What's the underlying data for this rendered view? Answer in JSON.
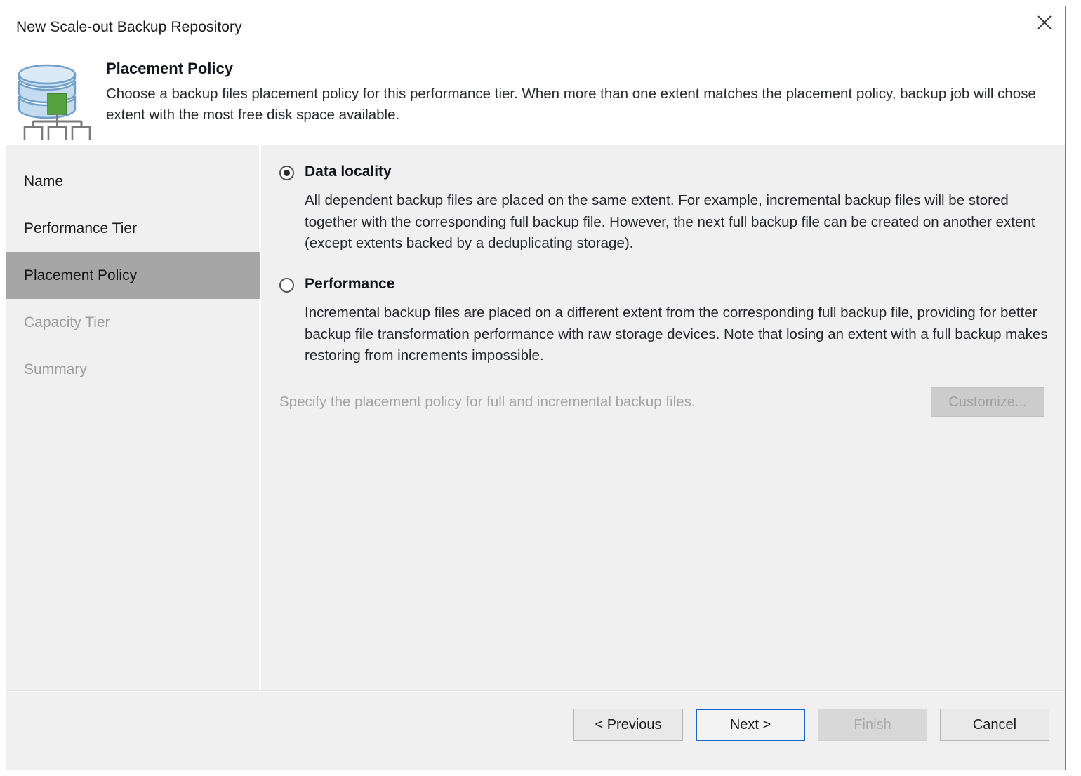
{
  "window": {
    "title": "New Scale-out Backup Repository",
    "close_icon": "close-icon"
  },
  "header": {
    "icon": "scale-out-repository-icon",
    "title": "Placement Policy",
    "description": "Choose a backup files placement policy for this performance tier. When more than one extent matches the placement policy, backup job will chose extent with the most free disk space available."
  },
  "sidebar": {
    "items": [
      {
        "label": "Name",
        "state": "normal"
      },
      {
        "label": "Performance Tier",
        "state": "normal"
      },
      {
        "label": "Placement Policy",
        "state": "active"
      },
      {
        "label": "Capacity Tier",
        "state": "disabled"
      },
      {
        "label": "Summary",
        "state": "disabled"
      }
    ]
  },
  "main": {
    "options": [
      {
        "label": "Data locality",
        "selected": true,
        "description": "All dependent backup files are placed on the same extent. For example, incremental backup files will be stored together with the corresponding full backup file. However, the next full backup file can be created on another extent (except extents backed by a deduplicating storage)."
      },
      {
        "label": "Performance",
        "selected": false,
        "description": "Incremental backup files are placed on a different extent from the corresponding full backup file, providing for better backup file transformation performance with raw storage devices. Note that losing an extent with a full backup makes restoring from increments impossible."
      }
    ],
    "customize": {
      "hint": "Specify the placement policy for full and incremental backup files.",
      "button_label": "Customize...",
      "disabled": true
    }
  },
  "footer": {
    "buttons": [
      {
        "label": "< Previous",
        "state": "normal"
      },
      {
        "label": "Next >",
        "state": "primary"
      },
      {
        "label": "Finish",
        "state": "disabled"
      },
      {
        "label": "Cancel",
        "state": "normal"
      }
    ]
  },
  "colors": {
    "accent": "#1567c8",
    "active_item_bg": "#a6a6a6",
    "panel_bg": "#f0f0f0",
    "icon_blue": "#b9d3ec",
    "icon_green": "#56a140"
  }
}
